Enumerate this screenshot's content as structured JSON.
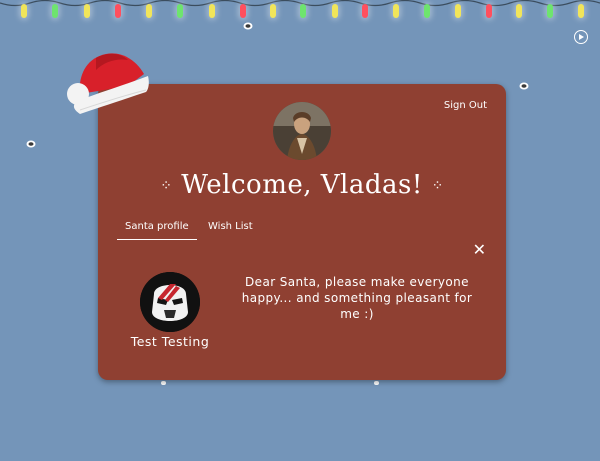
{
  "header": {
    "sign_out_label": "Sign Out",
    "welcome_text": "Welcome, Vladas!",
    "welcome_deco_left": "⁘",
    "welcome_deco_right": "⁘"
  },
  "tabs": [
    {
      "label": "Santa profile",
      "active": true
    },
    {
      "label": "Wish List",
      "active": false
    }
  ],
  "close_icon_glyph": "✕",
  "profile": {
    "name": "Test Testing",
    "message": "Dear Santa, please make everyone happy... and something pleasant for me :)"
  },
  "icons": {
    "play": "play-icon",
    "close": "close-icon",
    "hat": "santa-hat-icon",
    "snowflake": "snowflake-icon"
  },
  "colors": {
    "background": "#7495b9",
    "card": "#8f4032",
    "text": "#ffffff",
    "light_colors": [
      "#6ee46e",
      "#ff4f5e",
      "#f1e55a"
    ]
  }
}
